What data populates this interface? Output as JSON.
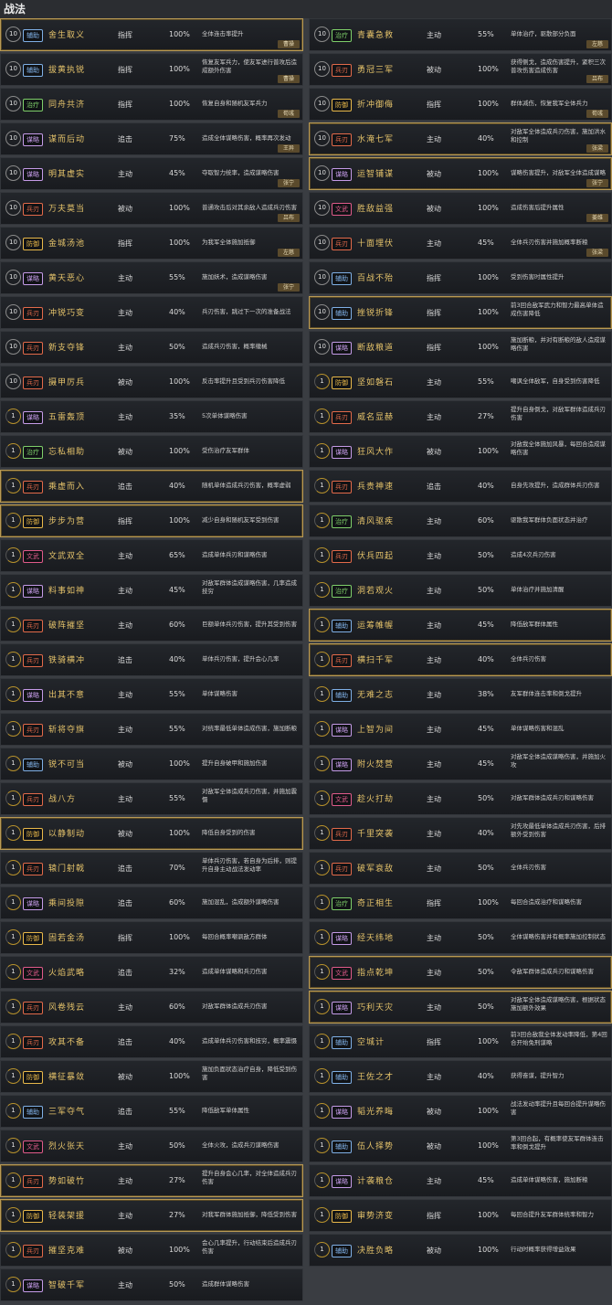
{
  "page_title": "战法",
  "columns": [
    [
      {
        "lvl": "10",
        "badge": "辅助",
        "name": "舍生取义",
        "type": "指挥",
        "rate": "100%",
        "desc": "全体连击率提升",
        "hero": "曹操",
        "gold": true
      },
      {
        "lvl": "10",
        "badge": "辅助",
        "name": "拔黄执锐",
        "type": "指挥",
        "rate": "100%",
        "desc": "恢复友军兵力，使友军进行普攻后造成额外伤害",
        "hero": "曹操"
      },
      {
        "lvl": "10",
        "badge": "治疗",
        "name": "同舟共济",
        "type": "指挥",
        "rate": "100%",
        "desc": "恢复自身和随机友军兵力",
        "hero": "荀彧"
      },
      {
        "lvl": "10",
        "badge": "谋略",
        "name": "谋而后动",
        "type": "追击",
        "rate": "75%",
        "desc": "造成全体谋略伤害，概率再次发动",
        "hero": "王异"
      },
      {
        "lvl": "10",
        "badge": "谋略",
        "name": "明其虚实",
        "type": "主动",
        "rate": "45%",
        "desc": "夺取智力统率，造成谋略伤害",
        "hero": "张宁"
      },
      {
        "lvl": "10",
        "badge": "兵刃",
        "name": "万夫莫当",
        "type": "被动",
        "rate": "100%",
        "desc": "普通攻击后对其余敌人造成兵刃伤害",
        "hero": "吕布"
      },
      {
        "lvl": "10",
        "badge": "防御",
        "name": "金城汤池",
        "type": "指挥",
        "rate": "100%",
        "desc": "为我军全体施加抵御",
        "hero": "左慈"
      },
      {
        "lvl": "10",
        "badge": "谋略",
        "name": "黄天恶心",
        "type": "主动",
        "rate": "55%",
        "desc": "施加妖术，造成谋略伤害",
        "hero": "张宁"
      },
      {
        "lvl": "10",
        "badge": "兵刃",
        "name": "冲锐巧变",
        "type": "主动",
        "rate": "40%",
        "desc": "兵刃伤害，跳过下一次的准备战法"
      },
      {
        "lvl": "10",
        "badge": "兵刃",
        "name": "新支夺锋",
        "type": "主动",
        "rate": "50%",
        "desc": "造成兵刃伤害，概率缴械"
      },
      {
        "lvl": "10",
        "badge": "兵刃",
        "name": "摄甲厉兵",
        "type": "被动",
        "rate": "100%",
        "desc": "反击率提升且受到兵刃伤害降低"
      },
      {
        "lvl": "1",
        "badge": "谋略",
        "name": "五雷轰顶",
        "type": "主动",
        "rate": "35%",
        "desc": "5次单体谋略伤害"
      },
      {
        "lvl": "1",
        "badge": "治疗",
        "name": "忘私相助",
        "type": "被动",
        "rate": "100%",
        "desc": "受伤治疗友军群体"
      },
      {
        "lvl": "1",
        "badge": "兵刃",
        "name": "乘虚而入",
        "type": "追击",
        "rate": "40%",
        "desc": "随机单体造成兵刃伤害，概率虚弱",
        "gold": true
      },
      {
        "lvl": "1",
        "badge": "防御",
        "name": "步步为营",
        "type": "指挥",
        "rate": "100%",
        "desc": "减少自身和随机友军受到伤害",
        "gold": true
      },
      {
        "lvl": "1",
        "badge": "文武",
        "name": "文武双全",
        "type": "主动",
        "rate": "65%",
        "desc": "造成单体兵刃和谋略伤害"
      },
      {
        "lvl": "1",
        "badge": "谋略",
        "name": "料事如神",
        "type": "主动",
        "rate": "45%",
        "desc": "对敌军群体造成谋略伤害，几率造成技穷"
      },
      {
        "lvl": "1",
        "badge": "兵刃",
        "name": "破阵摧坚",
        "type": "主动",
        "rate": "60%",
        "desc": "巨额单体兵刃伤害，提升其受到伤害"
      },
      {
        "lvl": "1",
        "badge": "兵刃",
        "name": "铁骑横冲",
        "type": "追击",
        "rate": "40%",
        "desc": "单体兵刃伤害，提升会心几率"
      },
      {
        "lvl": "1",
        "badge": "谋略",
        "name": "出其不意",
        "type": "主动",
        "rate": "55%",
        "desc": "单体谋略伤害"
      },
      {
        "lvl": "1",
        "badge": "兵刃",
        "name": "斩将夺旗",
        "type": "主动",
        "rate": "55%",
        "desc": "对统率最低单体造成伤害，施加断粮"
      },
      {
        "lvl": "1",
        "badge": "辅助",
        "name": "锐不可当",
        "type": "被动",
        "rate": "100%",
        "desc": "提升自身破甲和施加伤害"
      },
      {
        "lvl": "1",
        "badge": "兵刃",
        "name": "战八方",
        "type": "主动",
        "rate": "55%",
        "desc": "对敌军全体造成兵刃伤害，并施加震慑"
      },
      {
        "lvl": "1",
        "badge": "防御",
        "name": "以静制动",
        "type": "被动",
        "rate": "100%",
        "desc": "降低自身受到的伤害",
        "gold": true
      },
      {
        "lvl": "1",
        "badge": "兵刃",
        "name": "辕门射戟",
        "type": "追击",
        "rate": "70%",
        "desc": "单体兵刃伤害，若自身为后排，则提升自身主动战法发动率"
      },
      {
        "lvl": "1",
        "badge": "谋略",
        "name": "乘间投隙",
        "type": "追击",
        "rate": "60%",
        "desc": "施加混乱，造成额外谋略伤害"
      },
      {
        "lvl": "1",
        "badge": "防御",
        "name": "固若金汤",
        "type": "指挥",
        "rate": "100%",
        "desc": "每回合概率嘲讽敌方群体"
      },
      {
        "lvl": "1",
        "badge": "文武",
        "name": "火焰武略",
        "type": "追击",
        "rate": "32%",
        "desc": "造成单体谋略和兵刃伤害"
      },
      {
        "lvl": "1",
        "badge": "兵刃",
        "name": "风卷残云",
        "type": "主动",
        "rate": "60%",
        "desc": "对敌军群体造成兵刃伤害"
      },
      {
        "lvl": "1",
        "badge": "兵刃",
        "name": "攻其不备",
        "type": "追击",
        "rate": "40%",
        "desc": "造成单体兵刃伤害和技穷，概率震慑"
      },
      {
        "lvl": "1",
        "badge": "防御",
        "name": "横征暴敛",
        "type": "被动",
        "rate": "100%",
        "desc": "施加负面状态治疗自身，降低受到伤害"
      },
      {
        "lvl": "1",
        "badge": "辅助",
        "name": "三军夺气",
        "type": "追击",
        "rate": "55%",
        "desc": "降低敌军单体属性"
      },
      {
        "lvl": "1",
        "badge": "文武",
        "name": "烈火张天",
        "type": "主动",
        "rate": "50%",
        "desc": "全体火攻，造成兵刃谋略伤害"
      },
      {
        "lvl": "1",
        "badge": "兵刃",
        "name": "势如破竹",
        "type": "主动",
        "rate": "27%",
        "desc": "提升自身会心几率，对全体造成兵刃伤害",
        "gold": true
      },
      {
        "lvl": "1",
        "badge": "防御",
        "name": "轻装架援",
        "type": "主动",
        "rate": "27%",
        "desc": "对我军群体施加抵御，降低受到伤害",
        "gold": true
      },
      {
        "lvl": "1",
        "badge": "兵刃",
        "name": "摧坚克难",
        "type": "被动",
        "rate": "100%",
        "desc": "会心几率提升，行动结束后造成兵刃伤害"
      },
      {
        "lvl": "1",
        "badge": "谋略",
        "name": "智破千军",
        "type": "主动",
        "rate": "50%",
        "desc": "造成群体谋略伤害"
      }
    ],
    [
      {
        "lvl": "10",
        "badge": "治疗",
        "name": "青囊急救",
        "type": "主动",
        "rate": "55%",
        "desc": "单体治疗，驱散部分负面",
        "hero": "左慈"
      },
      {
        "lvl": "10",
        "badge": "兵刃",
        "name": "勇冠三军",
        "type": "被动",
        "rate": "100%",
        "desc": "获得侧戈，造成伤害提升，紧积三次普攻伤害造成伤害",
        "hero": "吕布"
      },
      {
        "lvl": "10",
        "badge": "防御",
        "name": "折冲御侮",
        "type": "指挥",
        "rate": "100%",
        "desc": "群体减伤，恢复我军全体兵力",
        "hero": "荀彧"
      },
      {
        "lvl": "10",
        "badge": "兵刃",
        "name": "水淹七军",
        "type": "主动",
        "rate": "40%",
        "desc": "对敌军全体造成兵刃伤害，施加洪水和控制",
        "hero": "张梁",
        "gold": true
      },
      {
        "lvl": "10",
        "badge": "谋略",
        "name": "运智铺谋",
        "type": "被动",
        "rate": "100%",
        "desc": "谋略伤害提升，对敌军全体造成谋略",
        "hero": "张宁",
        "gold": true
      },
      {
        "lvl": "10",
        "badge": "文武",
        "name": "胜敌益强",
        "type": "被动",
        "rate": "100%",
        "desc": "造成伤害后提升属性",
        "hero": "姜维"
      },
      {
        "lvl": "10",
        "badge": "兵刃",
        "name": "十面埋伏",
        "type": "主动",
        "rate": "45%",
        "desc": "全体兵刃伤害并施加概率断粮",
        "hero": "张梁"
      },
      {
        "lvl": "10",
        "badge": "辅助",
        "name": "百战不殆",
        "type": "指挥",
        "rate": "100%",
        "desc": "受到伤害时属性提升"
      },
      {
        "lvl": "10",
        "badge": "辅助",
        "name": "挫锐折锋",
        "type": "指挥",
        "rate": "100%",
        "desc": "前3回合敌军武力和智力最高单体造成伤害降低",
        "gold": true
      },
      {
        "lvl": "10",
        "badge": "谋略",
        "name": "断敌粮道",
        "type": "指挥",
        "rate": "100%",
        "desc": "施加断粮，并对有断粮的敌人造成谋略伤害"
      },
      {
        "lvl": "1",
        "badge": "防御",
        "name": "坚如磐石",
        "type": "主动",
        "rate": "55%",
        "desc": "嘲讽全体敌军，自身受到伤害降低"
      },
      {
        "lvl": "1",
        "badge": "兵刃",
        "name": "威名显赫",
        "type": "主动",
        "rate": "27%",
        "desc": "提升自身倒戈，对敌军群体造成兵刃伤害"
      },
      {
        "lvl": "1",
        "badge": "谋略",
        "name": "狂风大作",
        "type": "被动",
        "rate": "100%",
        "desc": "对敌我全体施加风暴，每回合造成谋略伤害"
      },
      {
        "lvl": "1",
        "badge": "兵刃",
        "name": "兵贵神速",
        "type": "追击",
        "rate": "40%",
        "desc": "自身先攻提升，造成群体兵刃伤害"
      },
      {
        "lvl": "1",
        "badge": "治疗",
        "name": "清风驱疾",
        "type": "主动",
        "rate": "60%",
        "desc": "驱散我军群体负面状态并治疗"
      },
      {
        "lvl": "1",
        "badge": "兵刃",
        "name": "伏兵四起",
        "type": "主动",
        "rate": "50%",
        "desc": "造成4次兵刃伤害"
      },
      {
        "lvl": "1",
        "badge": "治疗",
        "name": "洞若观火",
        "type": "主动",
        "rate": "50%",
        "desc": "单体治疗并施加清醒"
      },
      {
        "lvl": "1",
        "badge": "辅助",
        "name": "运筹帷幄",
        "type": "主动",
        "rate": "45%",
        "desc": "降低敌军群体属性",
        "gold": true
      },
      {
        "lvl": "1",
        "badge": "兵刃",
        "name": "横扫千军",
        "type": "主动",
        "rate": "40%",
        "desc": "全体兵刃伤害",
        "gold": true
      },
      {
        "lvl": "1",
        "badge": "辅助",
        "name": "无难之志",
        "type": "主动",
        "rate": "38%",
        "desc": "友军群体连击率和倒戈提升"
      },
      {
        "lvl": "1",
        "badge": "谋略",
        "name": "上智为间",
        "type": "主动",
        "rate": "45%",
        "desc": "单体谋略伤害和混乱"
      },
      {
        "lvl": "1",
        "badge": "谋略",
        "name": "附火焚营",
        "type": "主动",
        "rate": "45%",
        "desc": "对敌军全体造成谋略伤害，并施加火攻"
      },
      {
        "lvl": "1",
        "badge": "文武",
        "name": "趁火打劫",
        "type": "主动",
        "rate": "50%",
        "desc": "对敌军群体造成兵刃和谋略伤害"
      },
      {
        "lvl": "1",
        "badge": "兵刃",
        "name": "千里突袭",
        "type": "主动",
        "rate": "40%",
        "desc": "对先攻最低单体造成兵刃伤害，后排额外受到伤害"
      },
      {
        "lvl": "1",
        "badge": "兵刃",
        "name": "破军衰敌",
        "type": "主动",
        "rate": "50%",
        "desc": "全体兵刃伤害"
      },
      {
        "lvl": "1",
        "badge": "治疗",
        "name": "奇正相生",
        "type": "指挥",
        "rate": "100%",
        "desc": "每回合造成治疗和谋略伤害"
      },
      {
        "lvl": "1",
        "badge": "谋略",
        "name": "经天纬地",
        "type": "主动",
        "rate": "50%",
        "desc": "全体谋略伤害并有概率施加控制状态"
      },
      {
        "lvl": "1",
        "badge": "文武",
        "name": "指点乾坤",
        "type": "主动",
        "rate": "50%",
        "desc": "令敌军群体造成兵刃和谋略伤害",
        "gold": true
      },
      {
        "lvl": "1",
        "badge": "谋略",
        "name": "巧利天灾",
        "type": "主动",
        "rate": "50%",
        "desc": "对敌军全体造成谋略伤害，根据状态施加额外效果",
        "gold": true
      },
      {
        "lvl": "1",
        "badge": "辅助",
        "name": "空城计",
        "type": "指挥",
        "rate": "100%",
        "desc": "前3回合敌我全体发动率降低，第4回合开始免刑谋略"
      },
      {
        "lvl": "1",
        "badge": "辅助",
        "name": "王佐之才",
        "type": "主动",
        "rate": "40%",
        "desc": "获得奋谋，提升智力"
      },
      {
        "lvl": "1",
        "badge": "谋略",
        "name": "韬光养晦",
        "type": "被动",
        "rate": "100%",
        "desc": "战法发动率提升且每回合提升谋略伤害"
      },
      {
        "lvl": "1",
        "badge": "辅助",
        "name": "伍人择势",
        "type": "被动",
        "rate": "100%",
        "desc": "第3回合起，有概率使友军群体连击率和倒戈提升"
      },
      {
        "lvl": "1",
        "badge": "谋略",
        "name": "计袭粮仓",
        "type": "主动",
        "rate": "45%",
        "desc": "造成单体谋略伤害，施加断粮"
      },
      {
        "lvl": "1",
        "badge": "防御",
        "name": "审势济变",
        "type": "指挥",
        "rate": "100%",
        "desc": "每回合提升友军群体统率和智力"
      },
      {
        "lvl": "1",
        "badge": "辅助",
        "name": "决胜负略",
        "type": "被动",
        "rate": "100%",
        "desc": "行动时概率获得增益效果"
      }
    ]
  ],
  "badge_colors": {
    "辅助": "#7fb0e6",
    "治疗": "#7ecf6a",
    "谋略": "#c59be8",
    "兵刃": "#e36a4a",
    "防御": "#e8b84a",
    "文武": "#e05a8a"
  }
}
